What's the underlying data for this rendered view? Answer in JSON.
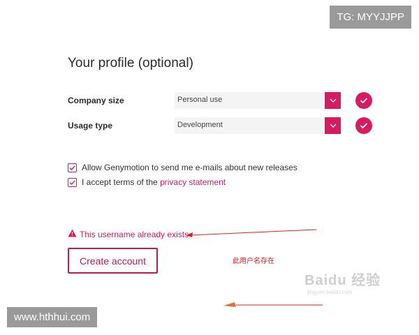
{
  "tg_badge": "TG: MYYJJPP",
  "profile": {
    "title": "Your profile (optional)",
    "company_size": {
      "label": "Company size",
      "value": "Personal use"
    },
    "usage_type": {
      "label": "Usage type",
      "value": "Development"
    }
  },
  "checkboxes": {
    "emails": {
      "text": "Allow Genymotion to send me e-mails about new releases",
      "checked": true
    },
    "terms": {
      "prefix": "I accept terms of the ",
      "link": "privacy statement",
      "checked": true
    }
  },
  "error": {
    "text": "This username already exists"
  },
  "create_button": {
    "label": "Create account"
  },
  "annotation": {
    "text": "此用户名存在"
  },
  "watermark": {
    "text": "Baidu 经验",
    "sub": "jingyan.baidu.com"
  },
  "site_badge": "www.hthhui.com",
  "colors": {
    "accent": "#d81b60",
    "annotation": "#e02020"
  }
}
